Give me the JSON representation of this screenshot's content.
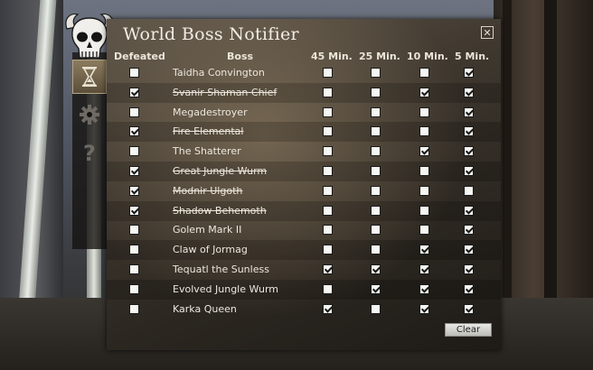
{
  "window": {
    "title": "World Boss Notifier",
    "close_label": "✕"
  },
  "side_menu": {
    "items": [
      {
        "icon": "hourglass-icon",
        "active": true
      },
      {
        "icon": "gear-icon",
        "active": false
      },
      {
        "icon": "help-icon",
        "active": false
      }
    ]
  },
  "columns": {
    "defeated": "Defeated",
    "boss": "Boss",
    "m45": "45 Min.",
    "m25": "25 Min.",
    "m10": "10 Min.",
    "m5": "5 Min."
  },
  "bosses": [
    {
      "name": "Taidha Convington",
      "defeated": false,
      "m45": false,
      "m25": false,
      "m10": false,
      "m5": true
    },
    {
      "name": "Svanir Shaman Chief",
      "defeated": true,
      "m45": false,
      "m25": false,
      "m10": true,
      "m5": true
    },
    {
      "name": "Megadestroyer",
      "defeated": false,
      "m45": false,
      "m25": false,
      "m10": false,
      "m5": true
    },
    {
      "name": "Fire Elemental",
      "defeated": true,
      "m45": false,
      "m25": false,
      "m10": false,
      "m5": true
    },
    {
      "name": "The Shatterer",
      "defeated": false,
      "m45": false,
      "m25": false,
      "m10": true,
      "m5": true
    },
    {
      "name": "Great Jungle Wurm",
      "defeated": true,
      "m45": false,
      "m25": false,
      "m10": false,
      "m5": true
    },
    {
      "name": "Modnir Ulgoth",
      "defeated": true,
      "m45": false,
      "m25": false,
      "m10": false,
      "m5": false
    },
    {
      "name": "Shadow Behemoth",
      "defeated": true,
      "m45": false,
      "m25": false,
      "m10": false,
      "m5": true
    },
    {
      "name": "Golem Mark II",
      "defeated": false,
      "m45": false,
      "m25": false,
      "m10": false,
      "m5": true
    },
    {
      "name": "Claw of Jormag",
      "defeated": false,
      "m45": false,
      "m25": false,
      "m10": true,
      "m5": true
    },
    {
      "name": "Tequatl the Sunless",
      "defeated": false,
      "m45": true,
      "m25": true,
      "m10": true,
      "m5": true
    },
    {
      "name": "Evolved Jungle Wurm",
      "defeated": false,
      "m45": false,
      "m25": true,
      "m10": true,
      "m5": true
    },
    {
      "name": "Karka Queen",
      "defeated": false,
      "m45": true,
      "m25": false,
      "m10": true,
      "m5": true
    }
  ],
  "footer": {
    "clear_label": "Clear"
  },
  "colors": {
    "accent": "#8c7c5f",
    "text": "#ece7de"
  }
}
